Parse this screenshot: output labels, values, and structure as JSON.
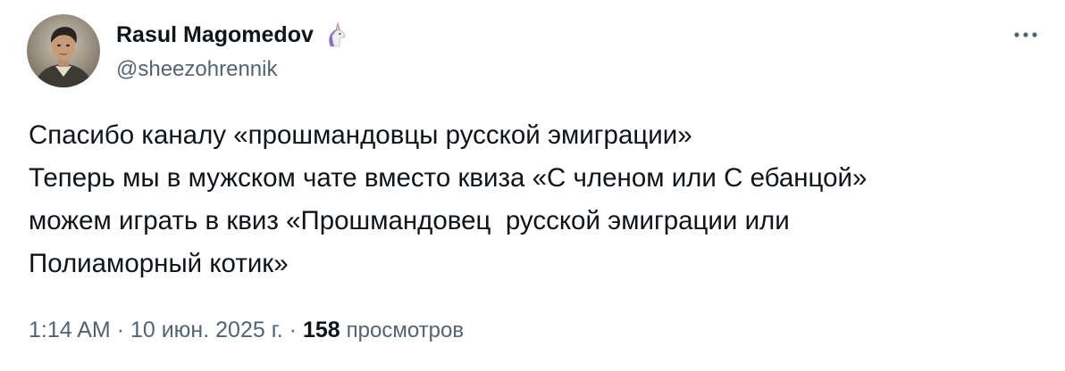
{
  "author": {
    "display_name": "Rasul Magomedov",
    "name_emoji": "unicorn-emoji",
    "handle": "@sheezohrennik",
    "avatar": "avatar-photo"
  },
  "more_icon": "more-horizontal-icon",
  "tweet": {
    "text": "Спасибо каналу «прошмандовцы русской эмиграции»\nТеперь мы в мужском чате вместо квиза «С членом или С ебанцой»\nможем играть в квиз «Прошмандовец  русской эмиграции или\nПолиаморный котик»"
  },
  "meta": {
    "time": "1:14 AM",
    "separator": "·",
    "date": "10 июн. 2025 г.",
    "views_count": "158",
    "views_label": "просмотров"
  },
  "colors": {
    "text_primary": "#0f1419",
    "text_secondary": "#536471",
    "background": "#ffffff"
  }
}
